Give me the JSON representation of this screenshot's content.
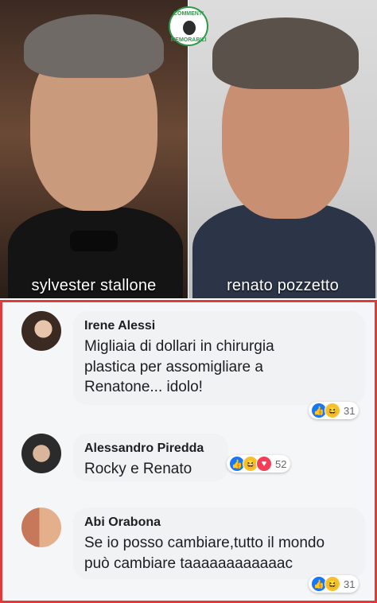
{
  "photos": {
    "left_caption": "sylvester stallone",
    "right_caption": "renato pozzetto"
  },
  "logo": {
    "top_text": "COMMENTI",
    "bottom_text": "MEMORABILI"
  },
  "comments": [
    {
      "author": "Irene Alessi",
      "text_lines": [
        "Migliaia di dollari in chirurgia",
        "plastica per assomigliare a",
        "Renatone... idolo!"
      ],
      "reactions": [
        "like",
        "haha"
      ],
      "reaction_count": "31"
    },
    {
      "author": "Alessandro Piredda",
      "text_lines": [
        "Rocky e Renato"
      ],
      "reactions": [
        "like",
        "haha",
        "love"
      ],
      "reaction_count": "52"
    },
    {
      "author": "Abi Orabona",
      "text_lines": [
        "Se io posso cambiare,tutto il mondo",
        "può cambiare taaaaaaaaaaaac"
      ],
      "reactions": [
        "like",
        "haha"
      ],
      "reaction_count": "31"
    }
  ],
  "colors": {
    "frame_border": "#e23a3a",
    "like": "#1877f2",
    "haha": "#f7c12d",
    "love": "#f33e58",
    "logo_green": "#2f9a4a"
  }
}
